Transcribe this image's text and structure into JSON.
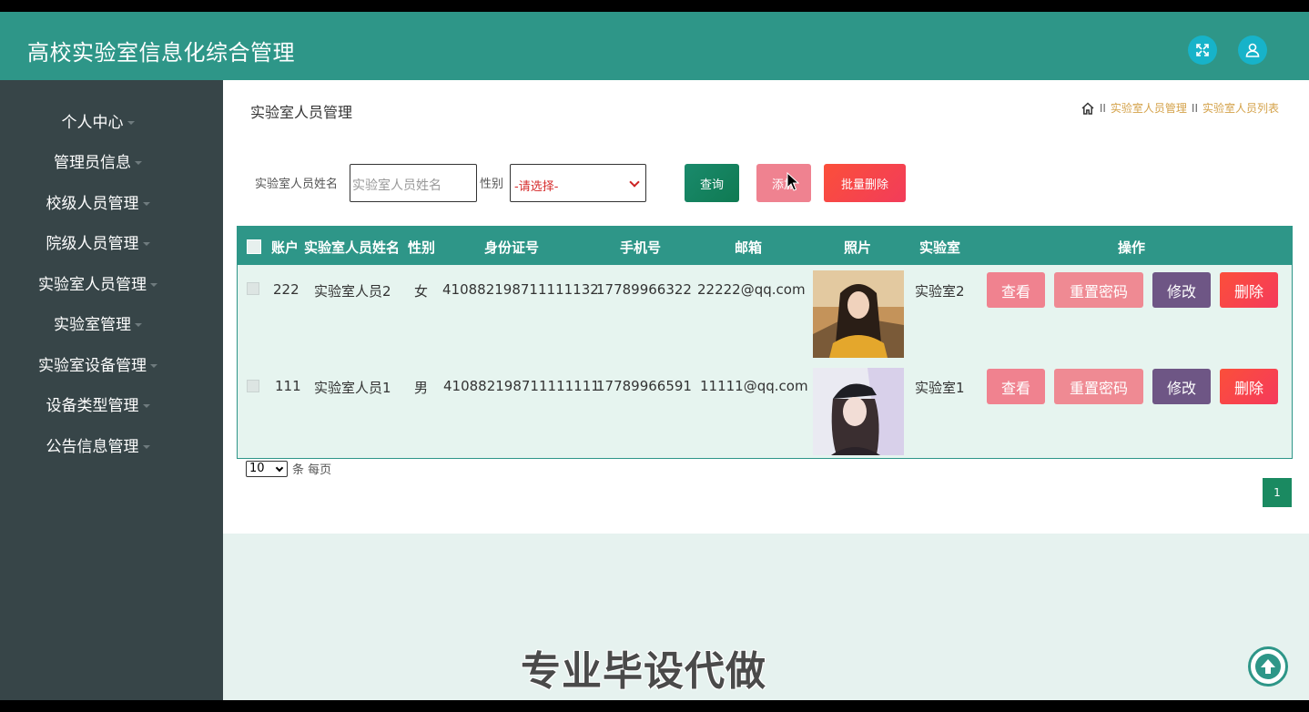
{
  "header": {
    "title": "高校实验室信息化综合管理",
    "fullscreen_icon": "expand-icon",
    "user_icon": "user-icon"
  },
  "sidebar": {
    "items": [
      {
        "label": "个人中心"
      },
      {
        "label": "管理员信息"
      },
      {
        "label": "校级人员管理"
      },
      {
        "label": "院级人员管理"
      },
      {
        "label": "实验室人员管理"
      },
      {
        "label": "实验室管理"
      },
      {
        "label": "实验室设备管理"
      },
      {
        "label": "设备类型管理"
      },
      {
        "label": "公告信息管理"
      }
    ]
  },
  "page": {
    "title": "实验室人员管理",
    "breadcrumb": [
      "实验室人员管理",
      "实验室人员列表"
    ],
    "breadcrumb_separator": "II"
  },
  "search": {
    "name_label": "实验室人员姓名",
    "name_placeholder": "实验室人员姓名",
    "gender_label": "性别",
    "gender_selected": "-请选择-",
    "query_label": "查询",
    "add_label": "添加",
    "batch_delete_label": "批量删除"
  },
  "table": {
    "headers": [
      "账户",
      "实验室人员姓名",
      "性别",
      "身份证号",
      "手机号",
      "邮箱",
      "照片",
      "实验室",
      "操作"
    ],
    "rows": [
      {
        "account": "222",
        "name": "实验室人员2",
        "gender": "女",
        "id_card": "410882198711111132",
        "phone": "17789966322",
        "email": "22222@qq.com",
        "lab": "实验室2"
      },
      {
        "account": "111",
        "name": "实验室人员1",
        "gender": "男",
        "id_card": "410882198711111111",
        "phone": "17789966591",
        "email": "11111@qq.com",
        "lab": "实验室1"
      }
    ],
    "actions": {
      "view": "查看",
      "reset": "重置密码",
      "edit": "修改",
      "delete": "删除"
    }
  },
  "pagination": {
    "per_page": "10",
    "per_page_suffix": "条 每页",
    "current_page": "1"
  },
  "watermark": "专业毕设代做",
  "colors": {
    "primary": "#2e9688",
    "sidebar": "#374548",
    "view": "#f0828f",
    "reset": "#ef8a93",
    "edit": "#6e5685",
    "delete": "#f83e4c"
  }
}
